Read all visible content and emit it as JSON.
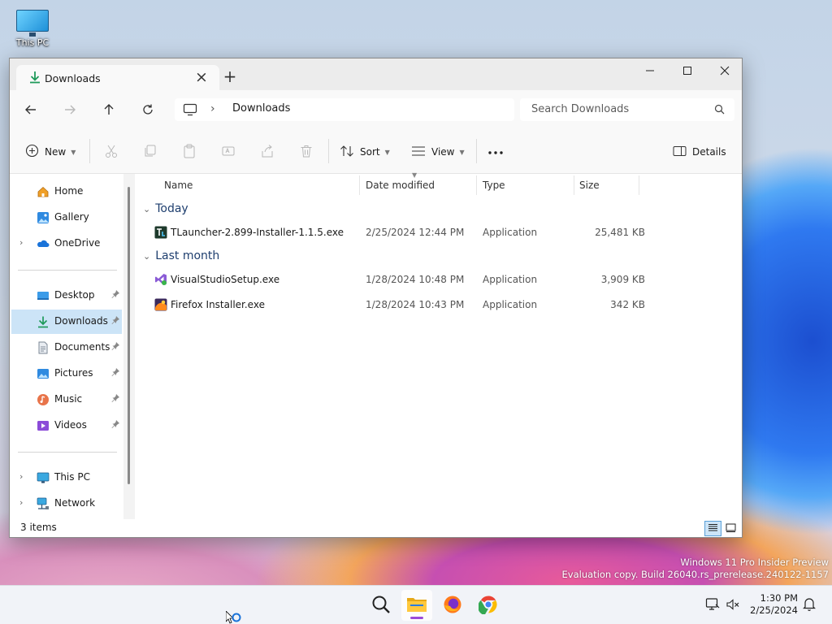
{
  "desktop": {
    "icon_label": "This PC",
    "watermark": [
      "Windows 11 Pro Insider Preview",
      "Evaluation copy. Build 26040.rs_prerelease.240122-1157"
    ]
  },
  "window": {
    "tab_title": "Downloads",
    "address": {
      "location": "Downloads"
    },
    "search": {
      "placeholder": "Search Downloads"
    },
    "commands": {
      "new_label": "New",
      "sort_label": "Sort",
      "view_label": "View",
      "details_label": "Details"
    },
    "sidebar": {
      "items": [
        {
          "label": "Home",
          "icon": "home-icon"
        },
        {
          "label": "Gallery",
          "icon": "gallery-icon"
        },
        {
          "label": "OneDrive",
          "icon": "onedrive-icon"
        },
        {
          "label": "Desktop",
          "icon": "desktop-icon"
        },
        {
          "label": "Downloads",
          "icon": "downloads-icon"
        },
        {
          "label": "Documents",
          "icon": "documents-icon"
        },
        {
          "label": "Pictures",
          "icon": "pictures-icon"
        },
        {
          "label": "Music",
          "icon": "music-icon"
        },
        {
          "label": "Videos",
          "icon": "videos-icon"
        },
        {
          "label": "This PC",
          "icon": "this-pc-icon"
        },
        {
          "label": "Network",
          "icon": "network-icon"
        }
      ]
    },
    "columns": [
      "Name",
      "Date modified",
      "Type",
      "Size"
    ],
    "groups": [
      {
        "label": "Today",
        "files": [
          {
            "name": "TLauncher-2.899-Installer-1.1.5.exe",
            "date": "2/25/2024 12:44 PM",
            "type": "Application",
            "size": "25,481 KB",
            "icon": "tlauncher-icon"
          }
        ]
      },
      {
        "label": "Last month",
        "files": [
          {
            "name": "VisualStudioSetup.exe",
            "date": "1/28/2024 10:48 PM",
            "type": "Application",
            "size": "3,909 KB",
            "icon": "visual-studio-icon"
          },
          {
            "name": "Firefox Installer.exe",
            "date": "1/28/2024 10:43 PM",
            "type": "Application",
            "size": "342 KB",
            "icon": "firefox-installer-icon"
          }
        ]
      }
    ],
    "status": {
      "item_count": "3 items"
    }
  },
  "taskbar": {
    "clock": {
      "time": "1:30 PM",
      "date": "2/25/2024"
    },
    "accent": "#9a4bd8"
  },
  "colors": {
    "selection": "#cce4f7",
    "accent": "#0067c0"
  }
}
